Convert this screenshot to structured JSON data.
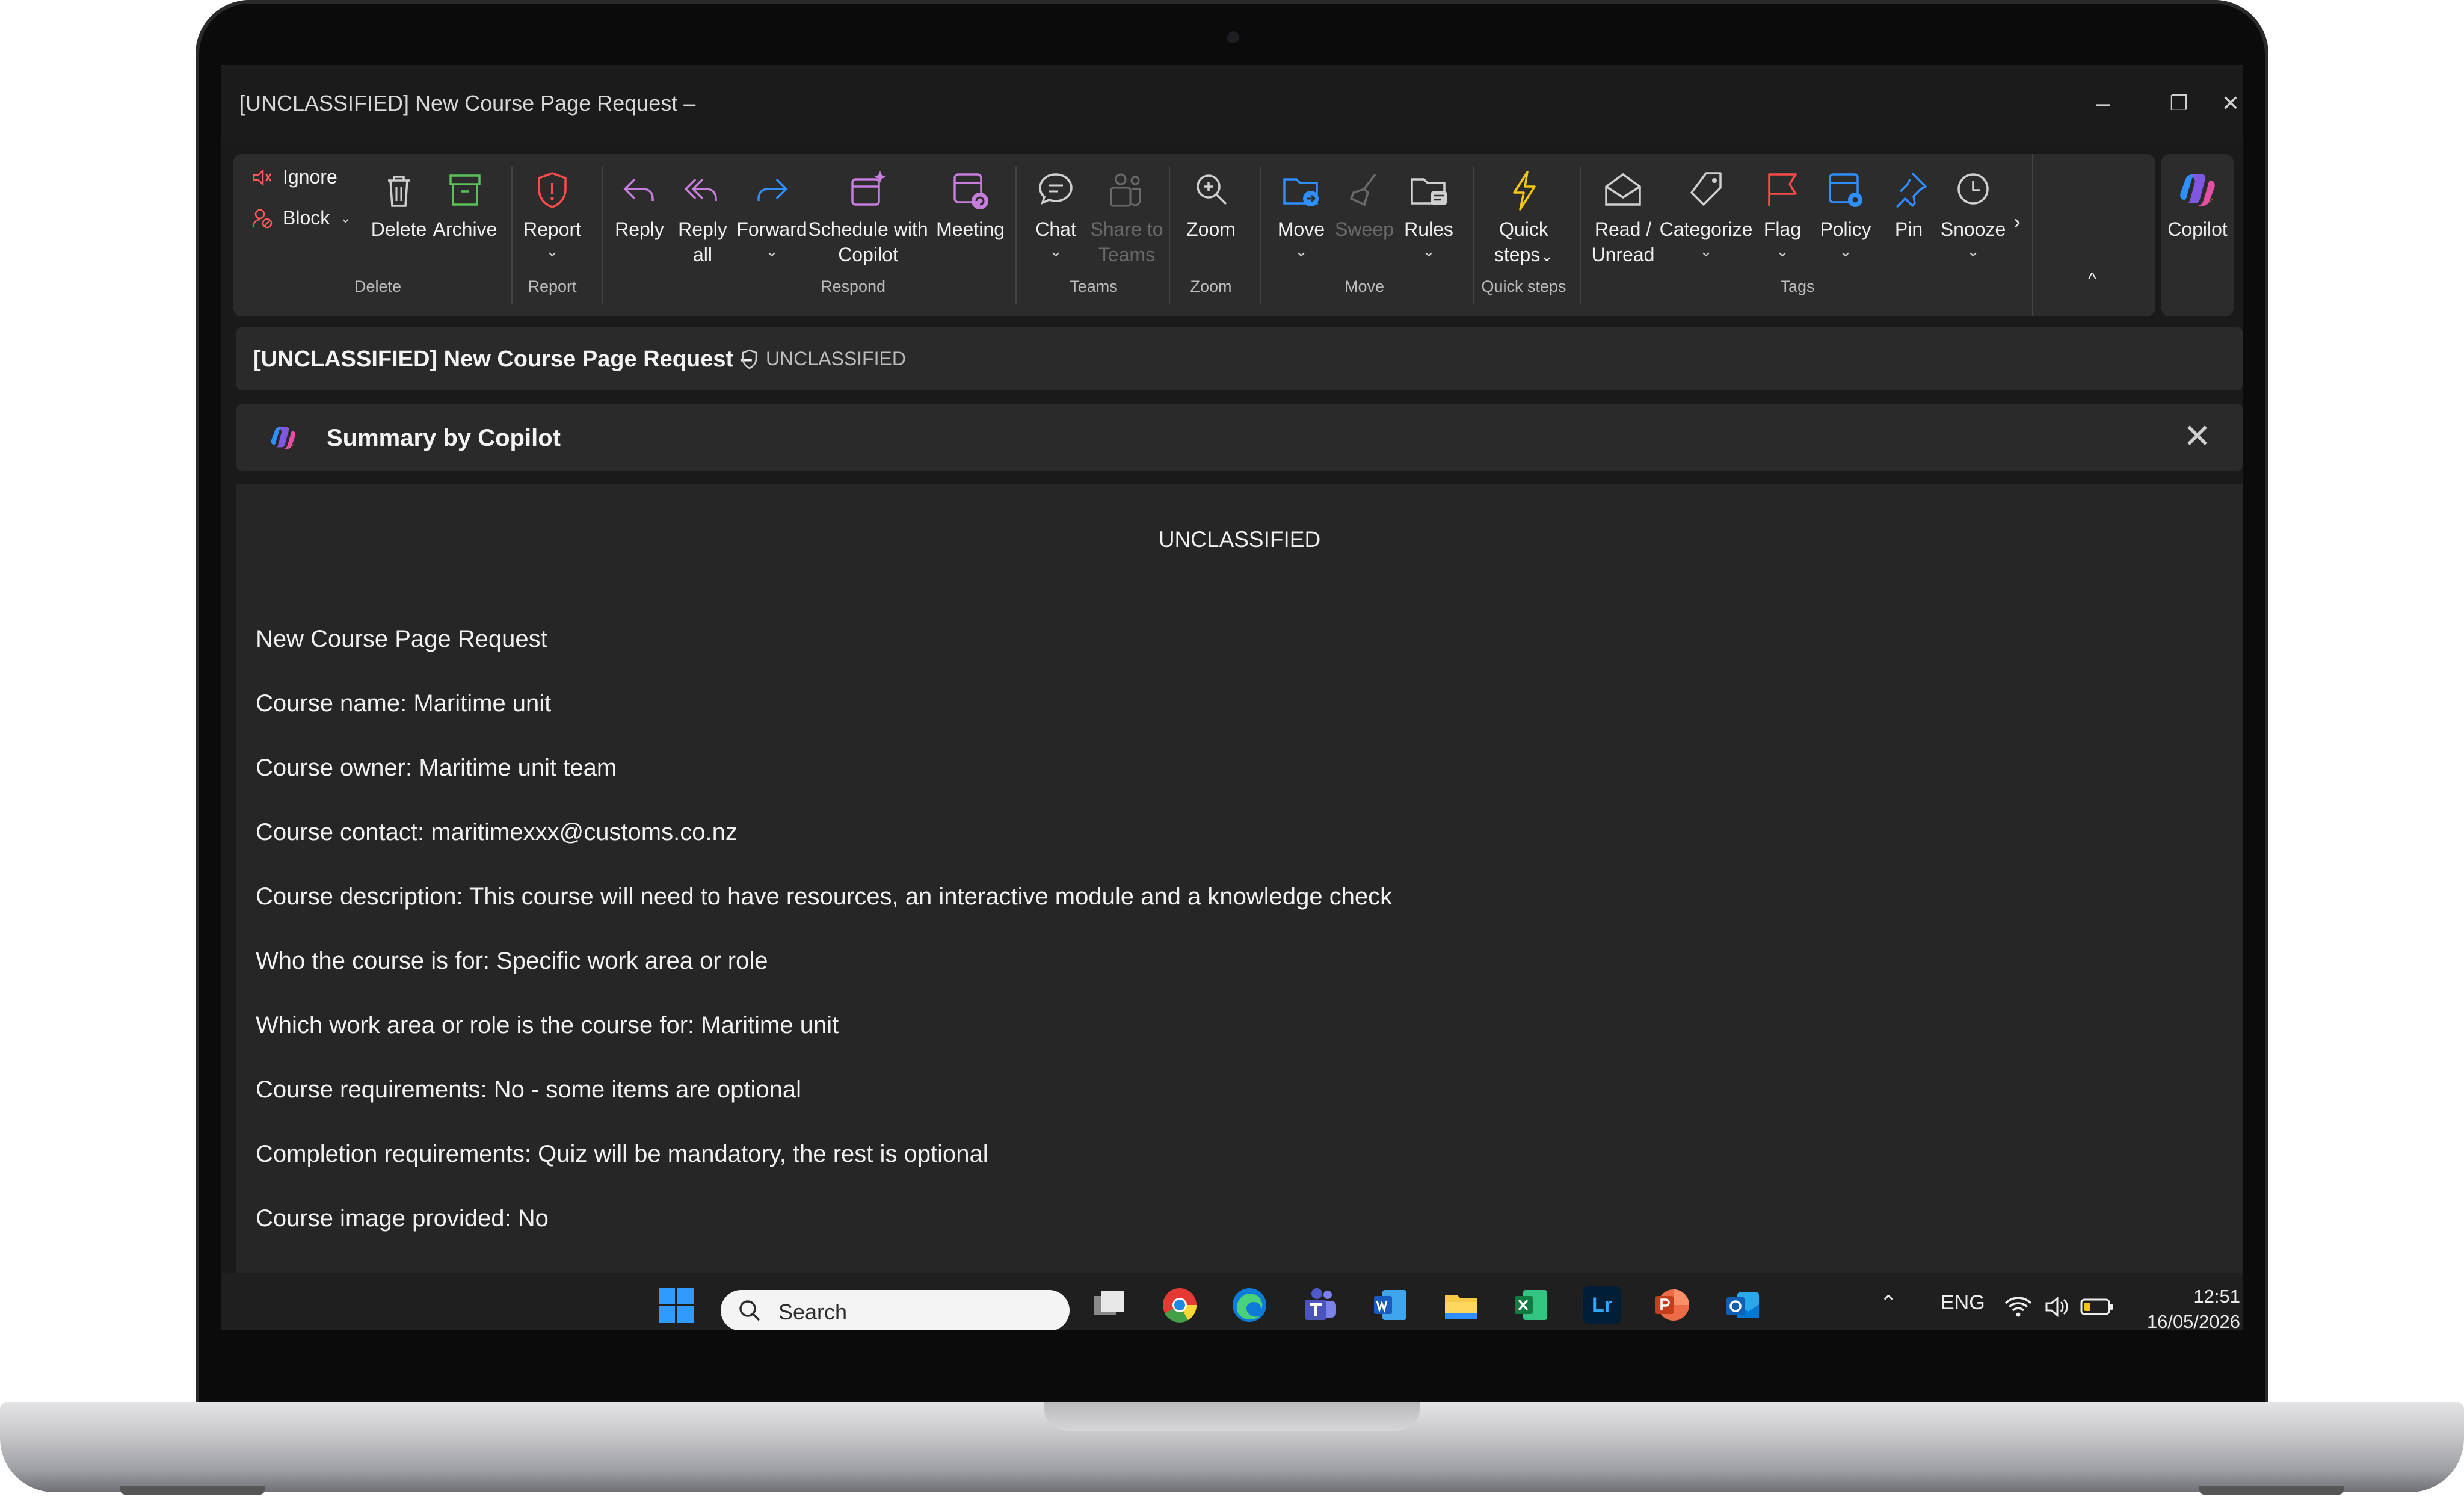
{
  "window": {
    "title": "[UNCLASSIFIED] New Course Page Request –",
    "minimize": "–",
    "restore": "❐",
    "close": "✕"
  },
  "ribbon": {
    "delete_group": {
      "ignore": "Ignore",
      "block": "Block",
      "delete": "Delete",
      "archive": "Archive",
      "label": "Delete"
    },
    "report_group": {
      "report": "Report",
      "label": "Report"
    },
    "respond_group": {
      "reply": "Reply",
      "reply_all_1": "Reply",
      "reply_all_2": "all",
      "forward": "Forward",
      "schedule_1": "Schedule with",
      "schedule_2": "Copilot",
      "meeting": "Meeting",
      "label": "Respond"
    },
    "teams_group": {
      "chat": "Chat",
      "share_1": "Share to",
      "share_2": "Teams",
      "label": "Teams"
    },
    "zoom_group": {
      "zoom": "Zoom",
      "label": "Zoom"
    },
    "move_group": {
      "move": "Move",
      "sweep": "Sweep",
      "rules": "Rules",
      "label": "Move"
    },
    "quick_group": {
      "quick_1": "Quick",
      "quick_2": "steps",
      "label": "Quick steps"
    },
    "tags_group": {
      "read_1": "Read /",
      "read_2": "Unread",
      "categorize": "Categorize",
      "flag": "Flag",
      "policy": "Policy",
      "pin": "Pin",
      "snooze": "Snooze",
      "label": "Tags"
    },
    "more": "›",
    "collapse": "^",
    "copilot": "Copilot"
  },
  "subject": {
    "title": "[UNCLASSIFIED] New Course Page Request –",
    "tag": "UNCLASSIFIED"
  },
  "summary": {
    "label": "Summary by Copilot",
    "close": "✕"
  },
  "email": {
    "classification": "UNCLASSIFIED",
    "lines": [
      "New Course Page Request",
      "Course name: Maritime unit",
      "Course owner: Maritime unit team",
      "Course contact: maritimexxx@customs.co.nz",
      "Course description: This course will need to have resources, an interactive module and a knowledge check",
      "Who the course is for: Specific work area or role",
      "Which work area or role is the course for: Maritime unit",
      "Course requirements: No - some items are optional",
      "Completion requirements: Quiz will be mandatory, the rest is optional",
      "Course image provided: No"
    ]
  },
  "taskbar": {
    "search_placeholder": "Search",
    "lang": "ENG",
    "time": "12:51",
    "date": "16/05/2026",
    "lr_label": "Lr"
  },
  "colors": {
    "accent_blue": "#2f8fff",
    "icon_purple": "#c77ddb",
    "danger_red": "#ff4b4b",
    "archive_green": "#5bc25b",
    "quick_yellow": "#f5c518"
  }
}
